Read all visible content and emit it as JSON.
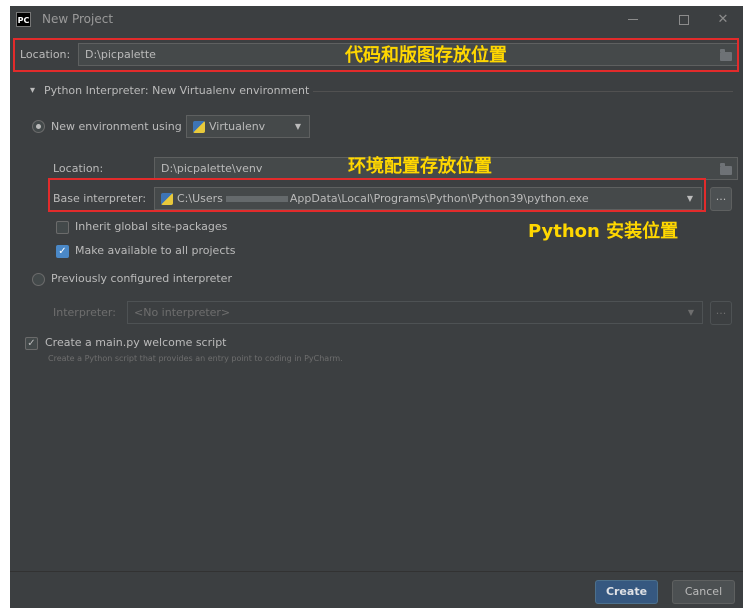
{
  "window": {
    "app_logo": "PC",
    "title": "New Project"
  },
  "location": {
    "label": "Location:",
    "value": "D:\\picpalette"
  },
  "interpreter_section": {
    "header": "Python Interpreter: New Virtualenv environment",
    "new_env_label": "New environment using",
    "env_tool": "Virtualenv",
    "venv_location_label": "Location:",
    "venv_location_value": "D:\\picpalette\\venv",
    "base_interpreter_label": "Base interpreter:",
    "base_interpreter_prefix": "C:\\Users",
    "base_interpreter_suffix": "AppData\\Local\\Programs\\Python\\Python39\\python.exe",
    "browse_label": "...",
    "inherit_label": "Inherit global site-packages",
    "inherit_checked": false,
    "make_available_label": "Make available to all projects",
    "make_available_checked": true,
    "previous_label": "Previously configured interpreter",
    "interpreter_label": "Interpreter:",
    "interpreter_value": "<No interpreter>"
  },
  "welcome_script": {
    "label": "Create a main.py welcome script",
    "checked": true,
    "description": "Create a Python script that provides an entry point to coding in PyCharm."
  },
  "annotations": {
    "code_location": "代码和版图存放位置",
    "env_location": "环境配置存放位置",
    "python_install": "Python 安装位置"
  },
  "footer": {
    "create_label": "Create",
    "cancel_label": "Cancel"
  },
  "colors": {
    "window_bg": "#3c3f41",
    "accent": "#365880",
    "annotation": "#ffd700",
    "highlight_box": "#e22b2b"
  }
}
